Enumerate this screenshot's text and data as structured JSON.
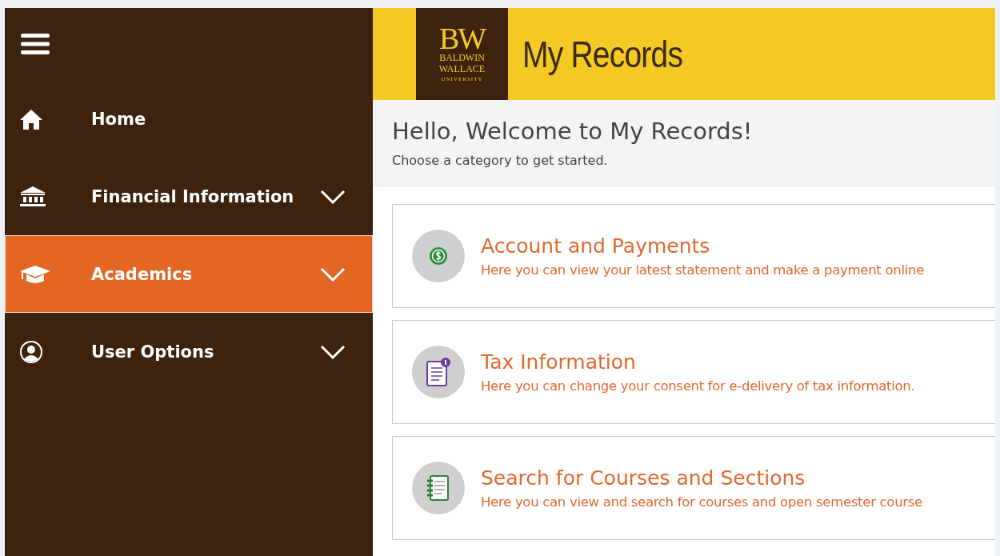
{
  "sidebar": {
    "items": [
      {
        "label": "Home",
        "kind": "link",
        "selected": false
      },
      {
        "label": "Financial Information",
        "kind": "menu",
        "selected": false,
        "expanded": false
      },
      {
        "label": "Academics",
        "kind": "menu",
        "selected": true,
        "expanded": false
      },
      {
        "label": "User Options",
        "kind": "menu",
        "selected": false,
        "expanded": false
      }
    ]
  },
  "header": {
    "logo": {
      "initials": "BW",
      "line_1": "BALDWIN",
      "line_2": "WALLACE",
      "line_3": "UNIVERSITY"
    },
    "title": "My Records"
  },
  "welcome": {
    "heading": "Hello, Welcome to My Records!",
    "subheading": "Choose a category to get started."
  },
  "cards": [
    {
      "title": "Account and Payments",
      "description": "Here you can view your latest statement and make a payment online"
    },
    {
      "title": "Tax Information",
      "description": "Here you can change your consent for e-delivery of tax information."
    },
    {
      "title": "Search for Courses and Sections",
      "description": "Here you can view and search for courses and open semester course"
    }
  ]
}
